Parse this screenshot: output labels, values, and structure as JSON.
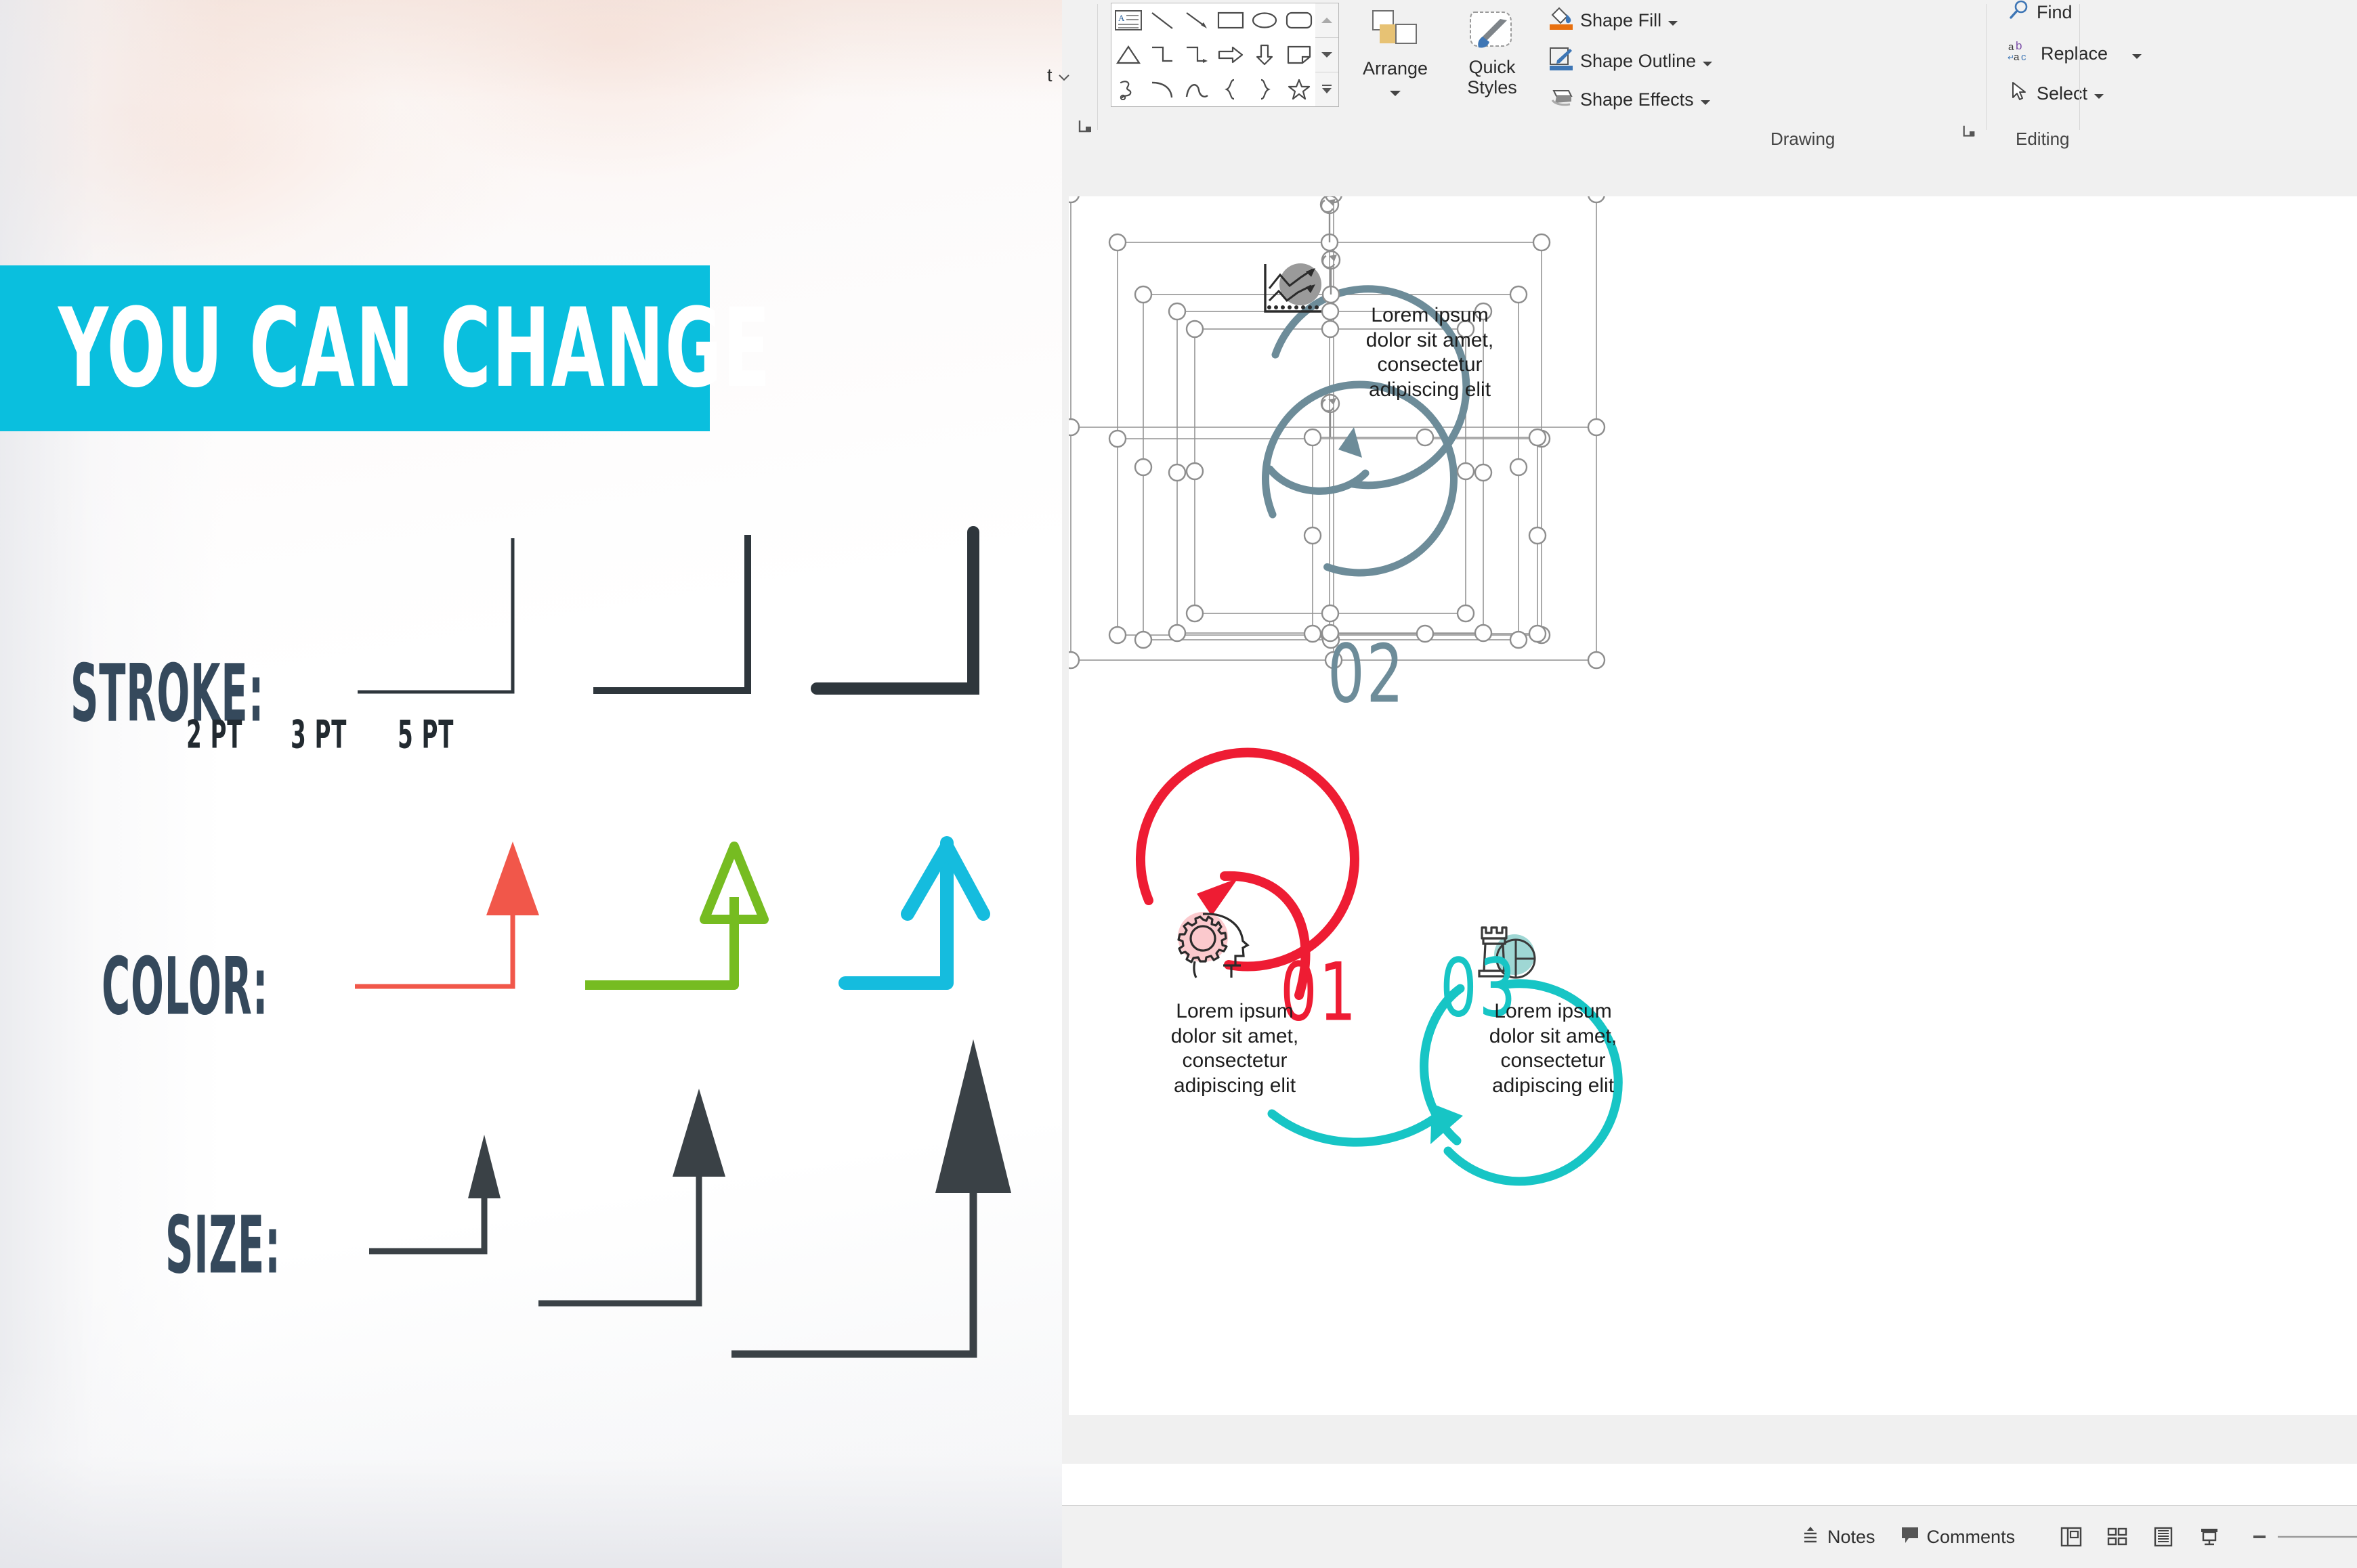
{
  "left_panel": {
    "banner_text": "YOU CAN CHANGE",
    "banner_color": "#0ABFDE",
    "rows": [
      {
        "label": "STROKE:",
        "label_color": "#35495C",
        "ticks": [
          "2 PT",
          "3 PT",
          "5 PT"
        ],
        "stroke_widths": [
          5,
          9,
          16
        ],
        "stroke_color": "#2E363C"
      },
      {
        "label": "COLOR:",
        "label_color": "#35495C",
        "swatches": [
          "#F1574A",
          "#76BC21",
          "#15BCDE"
        ],
        "head_styles": [
          "filled-triangle",
          "open-triangle",
          "open-vee"
        ]
      },
      {
        "label": "SIZE:",
        "label_color": "#35495C",
        "head_sizes": [
          "small",
          "medium",
          "large"
        ],
        "arrow_color": "#3A4146"
      }
    ]
  },
  "ppt": {
    "ribbon": {
      "cut_off_left_label": "t",
      "groups": [
        {
          "name": "Drawing",
          "title": "Drawing"
        },
        {
          "name": "Editing",
          "title": "Editing"
        }
      ],
      "shapes_gallery": {
        "name": "shapes-gallery",
        "items": [
          "text-box-icon",
          "line-icon",
          "line-arrow-icon",
          "rectangle-icon",
          "oval-icon",
          "rounded-rectangle-icon",
          "triangle-icon",
          "elbow-connector-icon",
          "elbow-arrow-connector-icon",
          "right-arrow-icon",
          "down-arrow-icon",
          "folded-corner-icon",
          "freeform-scribble-icon",
          "arc-icon",
          "curve-icon",
          "left-brace-icon",
          "right-brace-icon",
          "star-icon"
        ],
        "scroll_buttons": [
          "scroll-up-icon",
          "scroll-down-icon",
          "more-shapes-icon"
        ]
      },
      "arrange_label": "Arrange",
      "quick_styles_label": "Quick\nStyles",
      "shape_fill_label": "Shape Fill",
      "shape_outline_label": "Shape Outline",
      "shape_effects_label": "Shape Effects",
      "find_label": "Find",
      "replace_label": "Replace",
      "select_label": "Select"
    },
    "slide": {
      "shapes": [
        {
          "number": "01",
          "color": "#EE1C33",
          "icon": "gear-head-icon",
          "body": "Lorem ipsum\ndolor sit amet,\nconsectetur\nadipiscing elit"
        },
        {
          "number": "02",
          "color": "#6D8C99",
          "icon": "growth-chart-icon",
          "body": "Lorem ipsum\ndolor sit amet,\nconsectetur\nadipiscing elit"
        },
        {
          "number": "03",
          "color": "#17C5C5",
          "icon": "rook-pie-chart-icon",
          "body": "Lorem ipsum\ndolor sit amet,\nconsectetur\nadipiscing elit"
        }
      ],
      "selection_state": "multiple-shapes-selected"
    },
    "status_bar": {
      "notes_label": "Notes",
      "comments_label": "Comments",
      "views": [
        "normal-view-icon",
        "slide-sorter-icon",
        "reading-view-icon",
        "slideshow-icon"
      ],
      "zoom_out_label": "−",
      "zoom_in_label": "+"
    }
  }
}
